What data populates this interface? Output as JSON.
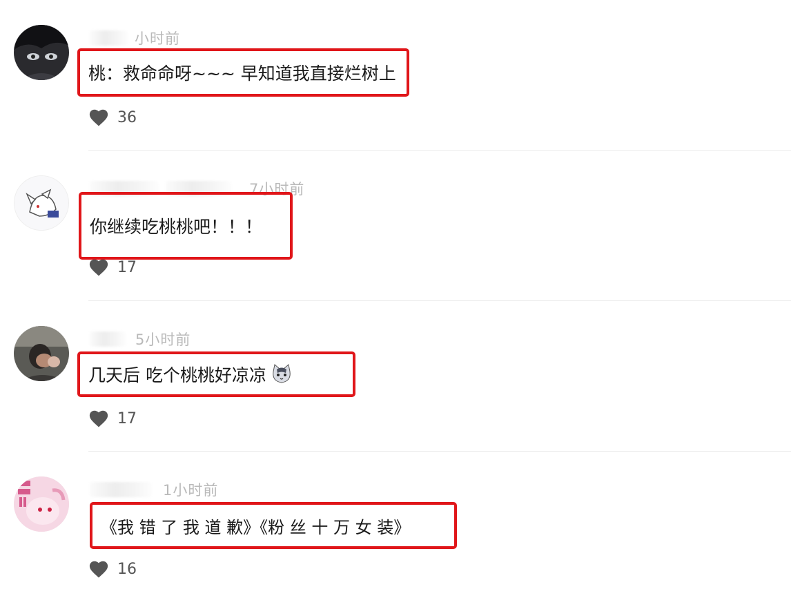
{
  "comments": [
    {
      "time": "小时前",
      "text": "桃：救命命呀~~~ 早知道我直接烂树上",
      "likes": "36"
    },
    {
      "time": "7小时前",
      "text": "你继续吃桃桃吧！！！",
      "likes": "17"
    },
    {
      "time": "5小时前",
      "text": "几天后 吃个桃桃好凉凉",
      "likes": "17",
      "emoji": "cat-face-emoji"
    },
    {
      "time": "1小时前",
      "text": "《我 错 了 我 道 歉》《粉 丝 十 万 女 装》",
      "likes": "16"
    }
  ],
  "colors": {
    "highlight_border": "#e0161a",
    "meta_text": "#b9b9b9",
    "heart": "#555555"
  },
  "icons": {
    "like": "heart-icon"
  }
}
